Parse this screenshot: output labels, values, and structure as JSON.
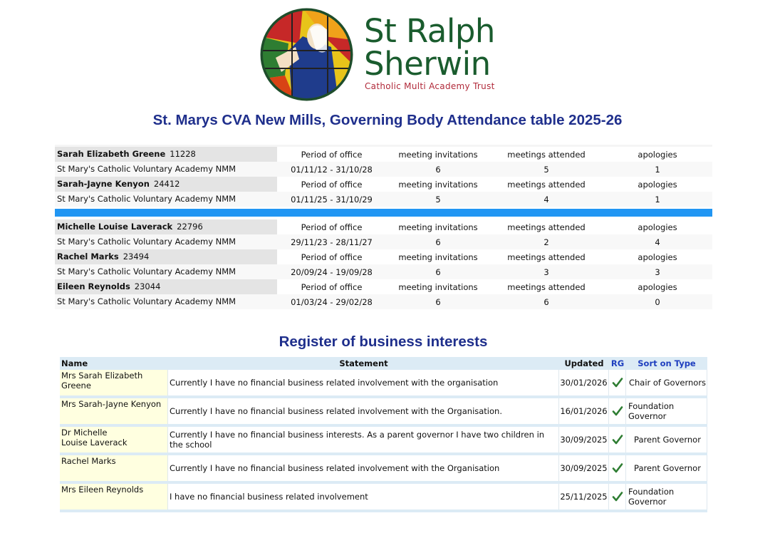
{
  "logo": {
    "name_line1": "St Ralph",
    "name_line2": "Sherwin",
    "subtitle": "Catholic Multi Academy Trust"
  },
  "title": "St. Marys CVA New Mills, Governing Body Attendance table 2025-26",
  "attendance": {
    "col_labels": {
      "period": "Period of office",
      "invitations": "meeting invitations",
      "attended": "meetings attended",
      "apologies": "apologies"
    },
    "group_a": [
      {
        "name": "Sarah Elizabeth Greene",
        "id": "11228",
        "school": "St Mary's Catholic Voluntary Academy NMM",
        "period": "01/11/12 - 31/10/28",
        "invitations": "6",
        "attended": "5",
        "apologies": "1"
      },
      {
        "name": "Sarah-Jayne Kenyon",
        "id": "24412",
        "school": "St Mary's Catholic Voluntary Academy NMM",
        "period": "01/11/25 - 31/10/29",
        "invitations": "5",
        "attended": "4",
        "apologies": "1"
      }
    ],
    "group_b": [
      {
        "name": "Michelle Louise Laverack",
        "id": "22796",
        "school": "St Mary's Catholic Voluntary Academy NMM",
        "period": "29/11/23 - 28/11/27",
        "invitations": "6",
        "attended": "2",
        "apologies": "4"
      },
      {
        "name": "Rachel Marks",
        "id": "23494",
        "school": "St Mary's Catholic Voluntary Academy NMM",
        "period": "20/09/24 - 19/09/28",
        "invitations": "6",
        "attended": "3",
        "apologies": "3"
      },
      {
        "name": "Eileen Reynolds",
        "id": "23044",
        "school": "St Mary's Catholic Voluntary Academy NMM",
        "period": "01/03/24 - 29/02/28",
        "invitations": "6",
        "attended": "6",
        "apologies": "0"
      }
    ]
  },
  "register": {
    "title": "Register of business interests",
    "headers": {
      "name": "Name",
      "statement": "Statement",
      "updated": "Updated",
      "rg": "RG",
      "sort": "Sort on Type"
    },
    "check_color": "#2e7d32",
    "rows": [
      {
        "name": "Mrs Sarah Elizabeth Greene",
        "statement": "Currently I have no financial business related involvement with the organisation",
        "updated": "30/01/2026",
        "type": "Chair of Governors"
      },
      {
        "name": "Mrs Sarah-Jayne Kenyon",
        "statement": "Currently I have no financial business related involvement with the Organisation.",
        "updated": "16/01/2026",
        "type": "Foundation Governor"
      },
      {
        "name": "Dr Michelle\nLouise Laverack",
        "statement": "Currently I have no financial business interests. As a parent governor I have two children in the school",
        "updated": "30/09/2025",
        "type": "Parent Governor"
      },
      {
        "name": " Rachel Marks",
        "statement": "Currently I have no financial business related involvement with the Organisation",
        "updated": "30/09/2025",
        "type": "Parent Governor"
      },
      {
        "name": "Mrs Eileen Reynolds",
        "statement": "I have no financial business related involvement",
        "updated": "25/11/2025",
        "type": "Foundation Governor"
      }
    ]
  }
}
